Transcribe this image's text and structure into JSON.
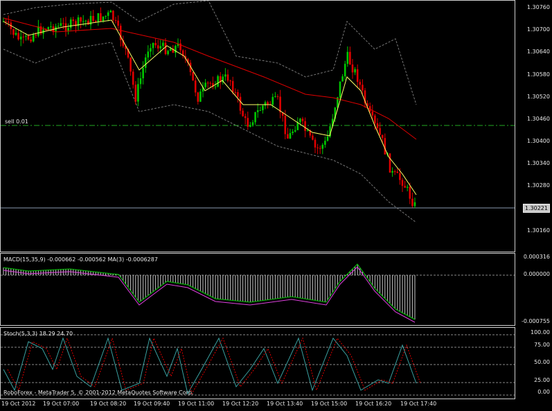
{
  "main_chart": {
    "price_ticks": [
      "1.30760",
      "1.30700",
      "1.30640",
      "1.30580",
      "1.30520",
      "1.30460",
      "1.30400",
      "1.30340",
      "1.30280",
      "1.30221",
      "1.30160"
    ],
    "current_price": "1.30221",
    "order_label": "sell 0.01",
    "colors": {
      "bull": "#00c800",
      "bear": "#e00000",
      "ma_slow": "#e00000",
      "ma_fast": "#ffff66",
      "bands": "#777777"
    }
  },
  "macd": {
    "label": "MACD(15,35,9) -0.000662 -0.000562 MA(3) -0.0006287",
    "ticks": [
      "0.000316",
      "0.000000",
      "-0.000755"
    ]
  },
  "stoch": {
    "label": "Stoch(5,3,3) 18.29 24.70",
    "ticks": [
      "100.00",
      "75.00",
      "50.00",
      "25.00",
      "0.00"
    ]
  },
  "copyright": "RoboForex - MetaTrader 5, © 2001-2012 MetaQuotes Software Corp.",
  "time_axis": [
    "19 Oct 2012",
    "19 Oct 07:00",
    "19 Oct 08:20",
    "19 Oct 09:40",
    "19 Oct 11:00",
    "19 Oct 12:20",
    "19 Oct 13:40",
    "19 Oct 15:00",
    "19 Oct 16:20",
    "19 Oct 17:40"
  ]
}
